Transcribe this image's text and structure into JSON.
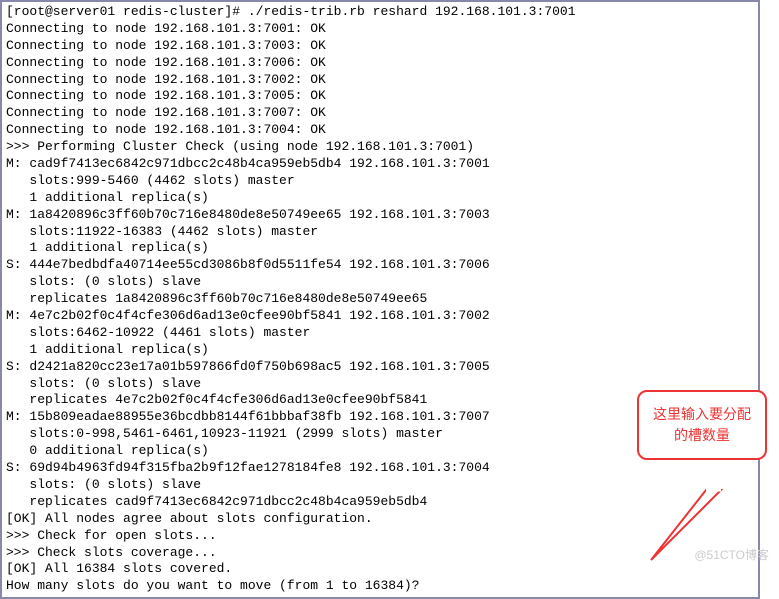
{
  "terminal": {
    "lines": [
      "[root@server01 redis-cluster]# ./redis-trib.rb reshard 192.168.101.3:7001",
      "Connecting to node 192.168.101.3:7001: OK",
      "Connecting to node 192.168.101.3:7003: OK",
      "Connecting to node 192.168.101.3:7006: OK",
      "Connecting to node 192.168.101.3:7002: OK",
      "Connecting to node 192.168.101.3:7005: OK",
      "Connecting to node 192.168.101.3:7007: OK",
      "Connecting to node 192.168.101.3:7004: OK",
      ">>> Performing Cluster Check (using node 192.168.101.3:7001)",
      "M: cad9f7413ec6842c971dbcc2c48b4ca959eb5db4 192.168.101.3:7001",
      "   slots:999-5460 (4462 slots) master",
      "   1 additional replica(s)",
      "M: 1a8420896c3ff60b70c716e8480de8e50749ee65 192.168.101.3:7003",
      "   slots:11922-16383 (4462 slots) master",
      "   1 additional replica(s)",
      "S: 444e7bedbdfa40714ee55cd3086b8f0d5511fe54 192.168.101.3:7006",
      "   slots: (0 slots) slave",
      "   replicates 1a8420896c3ff60b70c716e8480de8e50749ee65",
      "M: 4e7c2b02f0c4f4cfe306d6ad13e0cfee90bf5841 192.168.101.3:7002",
      "   slots:6462-10922 (4461 slots) master",
      "   1 additional replica(s)",
      "S: d2421a820cc23e17a01b597866fd0f750b698ac5 192.168.101.3:7005",
      "   slots: (0 slots) slave",
      "   replicates 4e7c2b02f0c4f4cfe306d6ad13e0cfee90bf5841",
      "M: 15b809eadae88955e36bcdbb8144f61bbbaf38fb 192.168.101.3:7007",
      "   slots:0-998,5461-6461,10923-11921 (2999 slots) master",
      "   0 additional replica(s)",
      "S: 69d94b4963fd94f315fba2b9f12fae1278184fe8 192.168.101.3:7004",
      "   slots: (0 slots) slave",
      "   replicates cad9f7413ec6842c971dbcc2c48b4ca959eb5db4",
      "[OK] All nodes agree about slots configuration.",
      ">>> Check for open slots...",
      ">>> Check slots coverage...",
      "[OK] All 16384 slots covered.",
      "How many slots do you want to move (from 1 to 16384)?"
    ]
  },
  "callout": {
    "text": "这里输入要分配的槽数量"
  },
  "watermark": {
    "text": "@51CTO博客"
  }
}
